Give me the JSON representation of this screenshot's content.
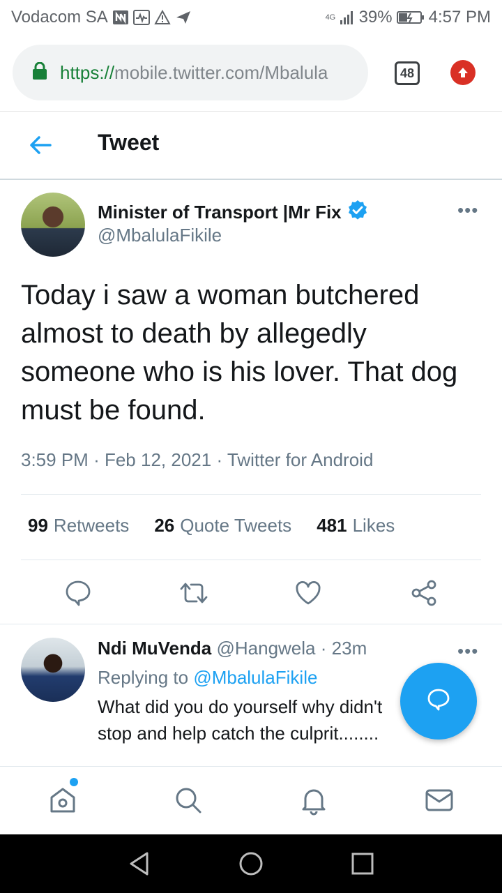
{
  "status_bar": {
    "carrier": "Vodacom SA",
    "network": "4G",
    "battery": "39%",
    "time": "4:57 PM"
  },
  "browser": {
    "url_protocol": "https://",
    "url_rest": "mobile.twitter.com/Mbalula",
    "tab_count": "48"
  },
  "header": {
    "title": "Tweet"
  },
  "tweet": {
    "author_name": "Minister of Transport |Mr Fix",
    "author_handle": "@MbalulaFikile",
    "more": "•••",
    "text": "Today i saw a woman butchered almost to death by allegedly someone who is his lover. That dog must be found.",
    "time": "3:59 PM",
    "sep1": "·",
    "date": "Feb 12, 2021",
    "sep2": "·",
    "source": "Twitter for Android",
    "stats": {
      "retweets_count": "99",
      "retweets_label": "Retweets",
      "quotes_count": "26",
      "quotes_label": "Quote Tweets",
      "likes_count": "481",
      "likes_label": "Likes"
    }
  },
  "reply": {
    "name": "Ndi MuVenda",
    "handle": "@Hangwela",
    "sep": "·",
    "age": "23m",
    "more": "•••",
    "replying_label": "Replying to",
    "replying_to": "@MbalulaFikile",
    "text": "What did you do yourself why didn't stop and help catch the culprit........"
  },
  "icons": {
    "lock": "lock-icon",
    "back": "back-arrow-icon",
    "verified": "verified-badge-icon",
    "reply": "reply-icon",
    "retweet": "retweet-icon",
    "like": "heart-icon",
    "share": "share-icon",
    "compose": "compose-reply-icon",
    "home": "home-icon",
    "search": "search-icon",
    "notifications": "bell-icon",
    "messages": "mail-icon"
  },
  "colors": {
    "twitter_blue": "#1da1f2",
    "secure_green": "#188038",
    "update_red": "#d93025"
  }
}
